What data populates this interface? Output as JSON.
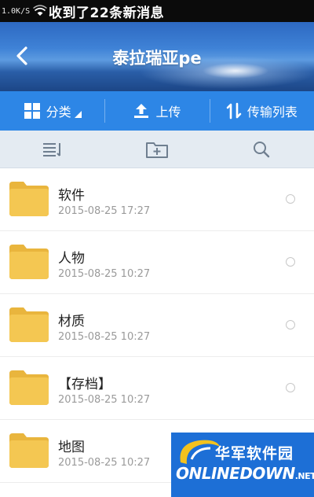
{
  "status_bar": {
    "speed": "1.0K/S",
    "notification": "收到了22条新消息"
  },
  "header": {
    "title": "泰拉瑞亚pe"
  },
  "toolbar": {
    "category_label": "分类",
    "upload_label": "上传",
    "transfer_label": "传输列表"
  },
  "files": [
    {
      "name": "软件",
      "date": "2015-08-25  17:27"
    },
    {
      "name": "人物",
      "date": "2015-08-25  10:27"
    },
    {
      "name": "材质",
      "date": "2015-08-25  10:27"
    },
    {
      "name": "【存档】",
      "date": "2015-08-25  10:27"
    },
    {
      "name": "地图",
      "date": "2015-08-25  10:27"
    }
  ],
  "watermark": {
    "name_cn": "华军软件园",
    "name_en": "ONLINEDOWN",
    "suffix": ".NET"
  },
  "colors": {
    "toolbar": "#2d86e6",
    "folder": "#f2c24b",
    "subbar": "#e4ebf2"
  }
}
